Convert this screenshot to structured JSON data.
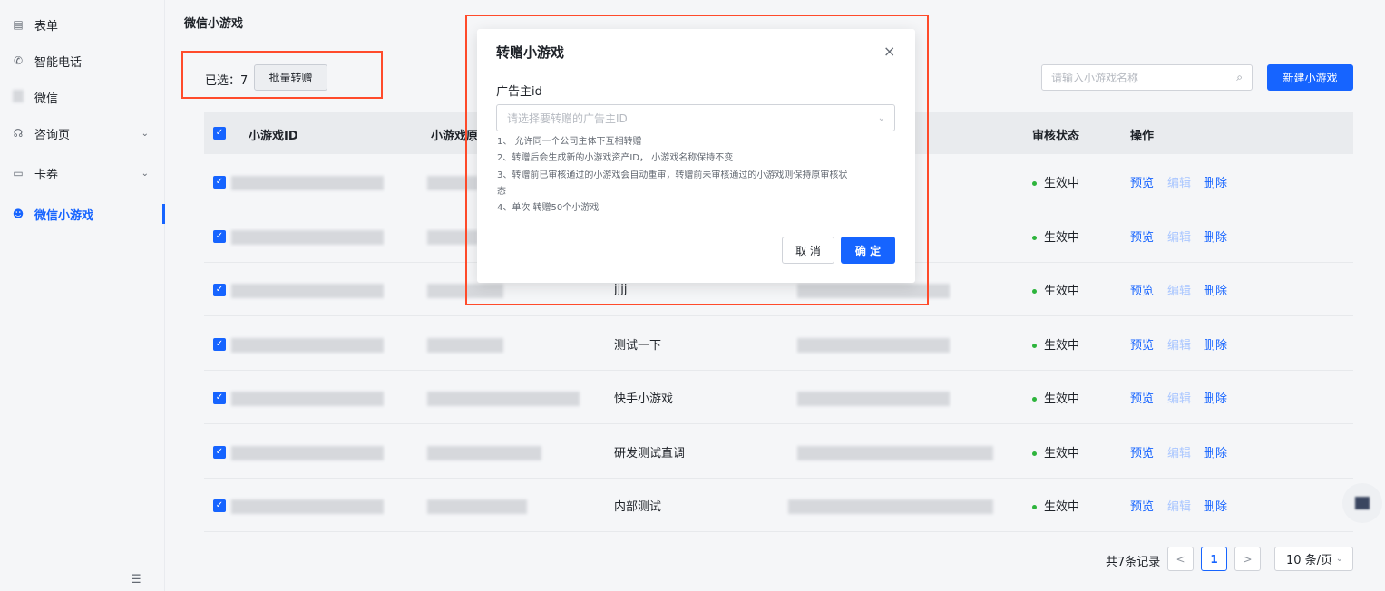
{
  "sidebar": {
    "items": [
      {
        "label": "表单",
        "icon": "form-icon",
        "glyph": "▤"
      },
      {
        "label": "智能电话",
        "icon": "phone-icon",
        "glyph": "✆"
      },
      {
        "label": "微信",
        "icon": "wechat-icon",
        "glyph": ""
      },
      {
        "label": "咨询页",
        "icon": "headset-icon",
        "glyph": "☊"
      },
      {
        "label": "卡券",
        "icon": "coupon-icon",
        "glyph": "▭"
      },
      {
        "label": "微信小游戏",
        "icon": "game-icon",
        "glyph": "☻"
      }
    ],
    "collapse_glyph": "☰"
  },
  "page": {
    "title": "微信小游戏"
  },
  "toolbar": {
    "selected_label": "已选：7",
    "batch_label": "批量转赠",
    "search_placeholder": "请输入小游戏名称",
    "new_label": "新建小游戏"
  },
  "table": {
    "headers": {
      "id": "小游戏ID",
      "origin": "小游戏原",
      "status": "审核状态",
      "ops": "操作"
    },
    "rows": [
      {
        "name": "",
        "status": "生效中"
      },
      {
        "name": "",
        "status": "生效中"
      },
      {
        "name": "jjjj",
        "status": "生效中"
      },
      {
        "name": "测试一下",
        "status": "生效中"
      },
      {
        "name": "快手小游戏",
        "status": "生效中"
      },
      {
        "name": "研发测试直调",
        "status": "生效中"
      },
      {
        "name": "内部测试",
        "status": "生效中"
      }
    ],
    "action_preview": "预览",
    "action_edit": "编辑",
    "action_delete": "删除"
  },
  "pagination": {
    "total": "共7条记录",
    "prev": "<",
    "current": "1",
    "next": ">",
    "page_size": "10 条/页"
  },
  "modal": {
    "title": "转赠小游戏",
    "close": "×",
    "field_label": "广告主id",
    "select_placeholder": "请选择要转赠的广告主ID",
    "notes": [
      "1、  允许同一个公司主体下互相转赠",
      "2、转赠后会生成新的小游戏资产ID， 小游戏名称保持不变",
      "3、转赠前已审核通过的小游戏会自动重审，转赠前未审核通过的小游戏则保持原审核状",
      "态",
      "4、单次      转赠50个小游戏"
    ],
    "cancel": "取 消",
    "ok": "确 定"
  },
  "colors": {
    "accent": "#1664ff",
    "annotation": "#ff4b2b",
    "status_ok": "#2db43c"
  }
}
